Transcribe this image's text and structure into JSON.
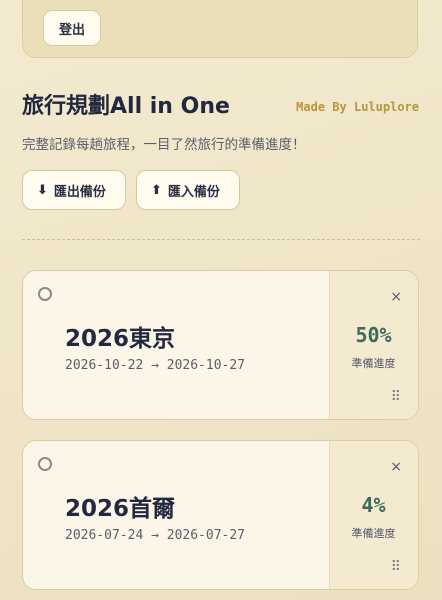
{
  "header": {
    "logout_label": "登出",
    "title": "旅行規劃All in One",
    "made_by": "Made By Luluplore",
    "subtitle": "完整記錄每趟旅程，一目了然旅行的準備進度！"
  },
  "actions": {
    "export_icon": "⬇",
    "export_label": "匯出備份",
    "import_icon": "⬆",
    "import_label": "匯入備份"
  },
  "trips": [
    {
      "name": "2026東京",
      "dates": "2026-10-22 → 2026-10-27",
      "progress": "50%",
      "progress_label": "準備進度"
    },
    {
      "name": "2026首爾",
      "dates": "2026-07-24 → 2026-07-27",
      "progress": "4%",
      "progress_label": "準備進度"
    }
  ],
  "icons": {
    "close": "×",
    "drag": "⠿"
  },
  "colors": {
    "accent_gold": "#b9953f",
    "progress_green": "#3d6a5a",
    "background": "#f1e8cb"
  }
}
